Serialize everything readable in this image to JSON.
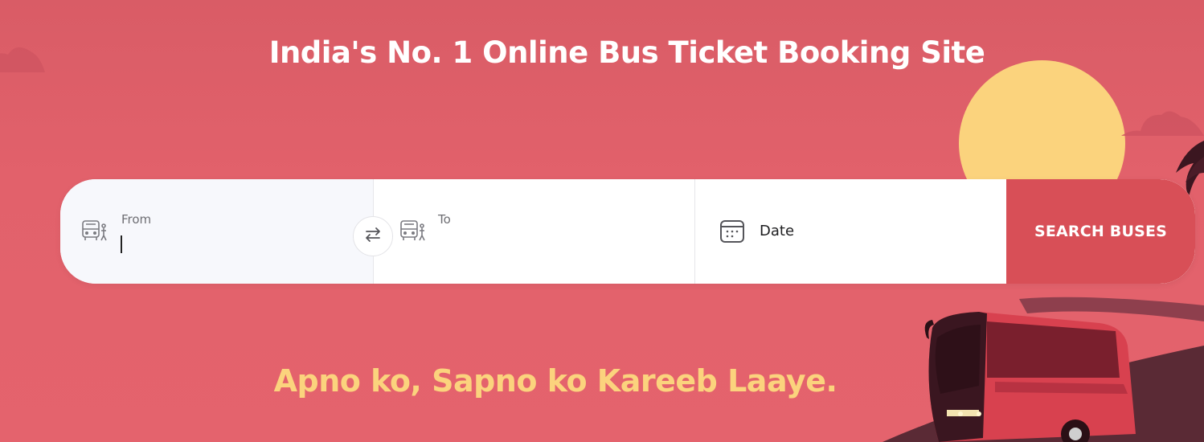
{
  "hero": {
    "headline": "India's No. 1 Online Bus Ticket Booking Site",
    "tagline": "Apno ko, Sapno ko Kareeb Laaye."
  },
  "search": {
    "from_label": "From",
    "to_label": "To",
    "date_label": "Date",
    "button_label": "SEARCH BUSES"
  },
  "colors": {
    "background": "#e2616b",
    "accent": "#d84f57",
    "sun": "#fbd37d",
    "tagline": "#fbd37d"
  },
  "icons": [
    "bus-stop-icon",
    "swap-icon",
    "calendar-icon"
  ]
}
